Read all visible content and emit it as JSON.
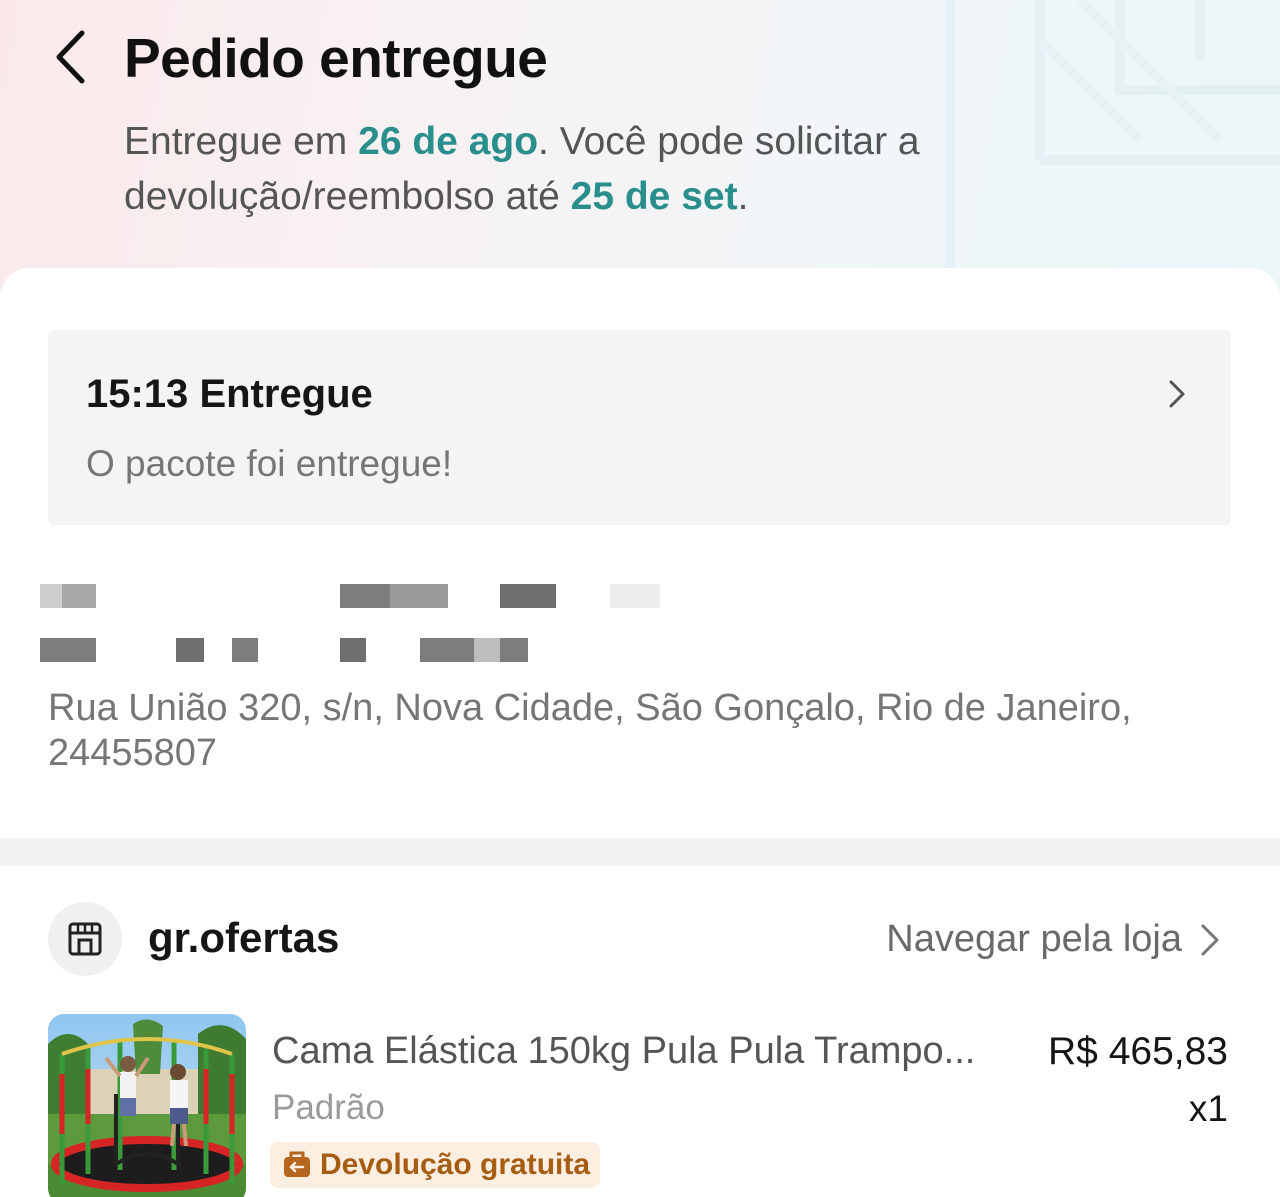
{
  "header": {
    "title": "Pedido entregue",
    "delivered_prefix": "Entregue em ",
    "delivered_date": "26 de ago",
    "return_text": ". Você pode solicitar a devolução/reembolso até ",
    "return_deadline": "25 de set",
    "period": ".",
    "accent_color": "#2a8f8c"
  },
  "status": {
    "time": "15:13",
    "title": "Entregue",
    "message": "O pacote foi entregue!"
  },
  "address": {
    "line": "Rua União 320, s/n, Nova Cidade, São Gonçalo, Rio de Janeiro, 24455807"
  },
  "store": {
    "name": "gr.ofertas",
    "browse_label": "Navegar pela loja",
    "icon": "store-icon"
  },
  "product": {
    "title": "Cama Elástica 150kg Pula Pula Trampo...",
    "variant": "Padrão",
    "price": "R$ 465,83",
    "quantity": "x1",
    "badge": "Devolução gratuita",
    "badge_color": "#a65d12"
  }
}
